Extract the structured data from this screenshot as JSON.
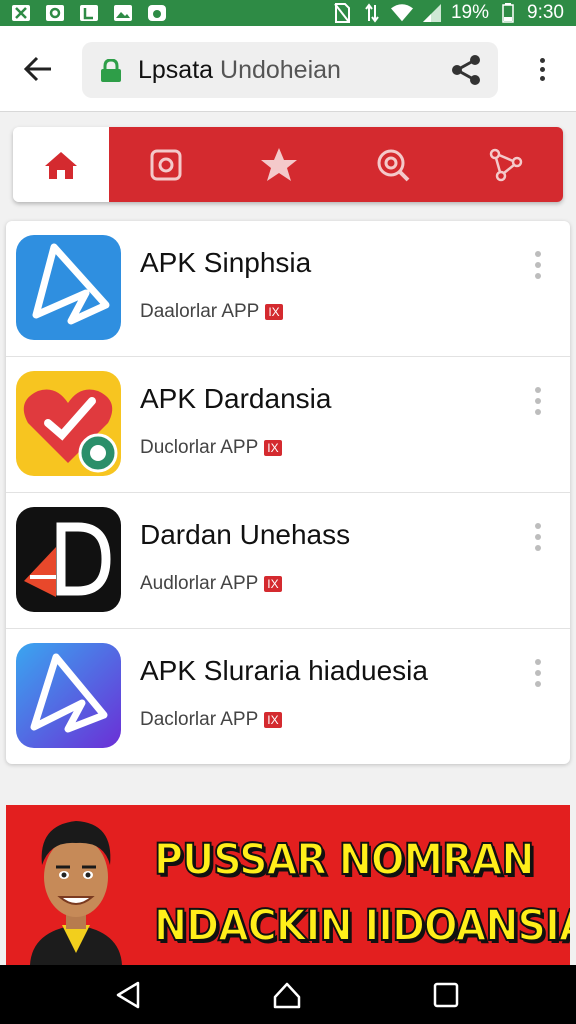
{
  "status_bar": {
    "battery_percent": "19%",
    "time": "9:30",
    "notification_icons": [
      "notification-icon",
      "notification-icon",
      "notification-icon",
      "image-icon",
      "notification-icon"
    ]
  },
  "browser": {
    "url_host": "Lpsata",
    "url_path": "Undoheian"
  },
  "tabs": [
    {
      "name": "home",
      "icon": "home-icon",
      "active": true
    },
    {
      "name": "instagram",
      "icon": "instagram-icon",
      "active": false
    },
    {
      "name": "favorites",
      "icon": "star-icon",
      "active": false
    },
    {
      "name": "search",
      "icon": "search-icon",
      "active": false
    },
    {
      "name": "share",
      "icon": "share-icon",
      "active": false
    }
  ],
  "apps": [
    {
      "name": "APK Sinphsia",
      "subtitle": "Daalorlar APP",
      "badge": "IX"
    },
    {
      "name": "APK Dardansia",
      "subtitle": "Duclorlar APP",
      "badge": "IX"
    },
    {
      "name": "Dardan Unehass",
      "subtitle": "Audlorlar APP",
      "badge": "IX"
    },
    {
      "name": "APK Sluraria hiaduesia",
      "subtitle": "Daclorlar APP",
      "badge": "IX"
    }
  ],
  "banner": {
    "line1": "PUSSAR NOMRAN",
    "line2": "NDACKIN IIDOANSIA"
  },
  "colors": {
    "status_bar": "#2e8b45",
    "accent_red": "#d42a2f",
    "banner_text": "#ffef1a"
  }
}
